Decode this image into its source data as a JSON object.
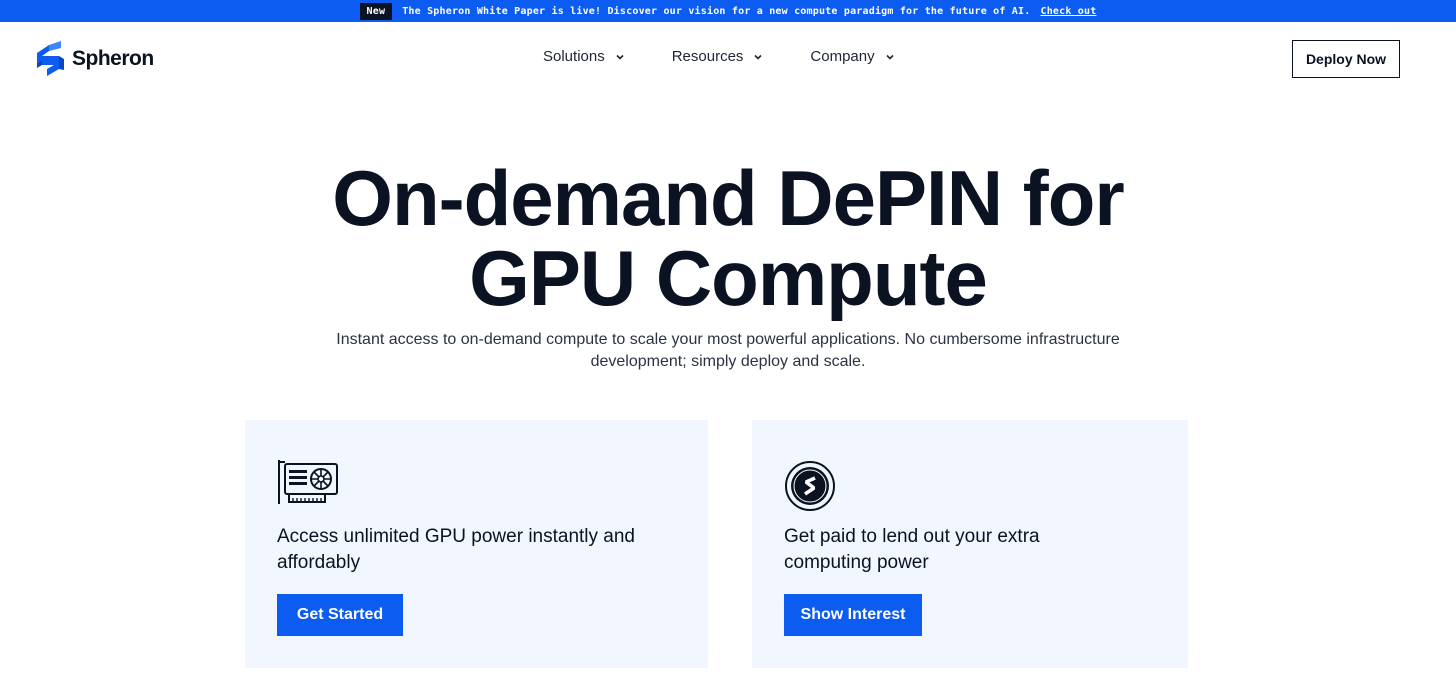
{
  "announcement": {
    "badge": "New",
    "message": "The Spheron White Paper is live! Discover our vision for a new compute paradigm for the future of AI.",
    "link": "Check out"
  },
  "header": {
    "logo_text": "Spheron",
    "nav": [
      {
        "label": "Solutions",
        "icon": "chevron-down-icon"
      },
      {
        "label": "Resources",
        "icon": "chevron-down-icon"
      },
      {
        "label": "Company",
        "icon": "chevron-down-icon"
      }
    ],
    "cta": "Deploy Now"
  },
  "hero": {
    "title_line1": "On-demand DePIN for",
    "title_line2": "GPU Compute",
    "subtitle_line1": "Instant access to on-demand compute to scale your most powerful applications. No cumbersome infrastructure",
    "subtitle_line2": "development; simply deploy and scale."
  },
  "cards": [
    {
      "icon": "gpu-card-icon",
      "text_line1": "Access unlimited GPU power instantly and",
      "text_line2": "affordably",
      "button": "Get Started"
    },
    {
      "icon": "spheron-coin-icon",
      "text_line1": "Get paid to lend out your extra",
      "text_line2": "computing power",
      "button": "Show Interest"
    }
  ],
  "colors": {
    "brand_blue": "#0c5cf2",
    "dark": "#0b1221",
    "card_bg": "#f2f6ff"
  }
}
